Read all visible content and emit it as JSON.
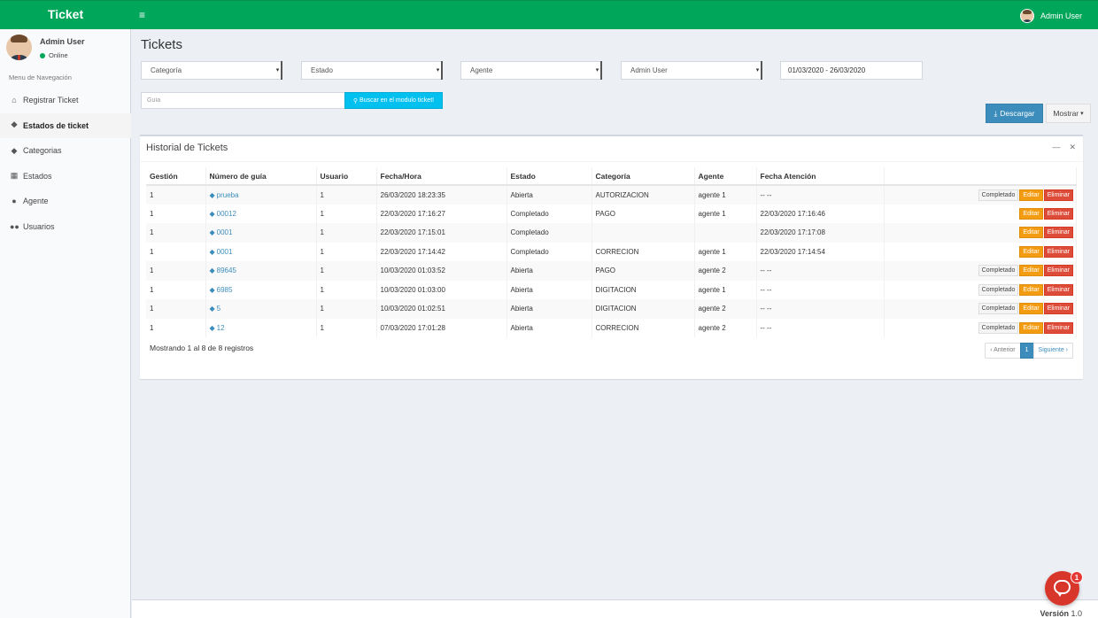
{
  "header": {
    "brand": "Ticket",
    "menu_icon": "hamburger-icon",
    "user_name": "Admin User"
  },
  "sidebar": {
    "user": {
      "name": "Admin User",
      "status": "Online"
    },
    "nav_header": "Menu de Navegación",
    "items": [
      {
        "label": "Registrar Ticket",
        "icon": "home-icon"
      },
      {
        "label": "Estados de ticket",
        "icon": "tags-icon",
        "active": true
      },
      {
        "label": "Categorias",
        "icon": "tag-icon"
      },
      {
        "label": "Estados",
        "icon": "grid-icon"
      },
      {
        "label": "Agente",
        "icon": "user-icon"
      },
      {
        "label": "Usuarios",
        "icon": "users-icon"
      }
    ]
  },
  "page": {
    "title": "Tickets"
  },
  "filters": {
    "categoria": "Categoría",
    "estado": "Estado",
    "agente": "Agente",
    "usuario": "Admin User",
    "date_range": "01/03/2020 - 26/03/2020"
  },
  "search": {
    "placeholder": "Guía",
    "button_label": "Buscar en el modulo ticket!"
  },
  "toolbar": {
    "download_label": "Descargar",
    "show_label": "Mostrar"
  },
  "box": {
    "title": "Historial de Tickets",
    "columns": [
      "Gestión",
      "Número de guía",
      "Usuario",
      "Fecha/Hora",
      "Estado",
      "Categoría",
      "Agente",
      "Fecha Atención",
      ""
    ],
    "rows": [
      {
        "gestion": "1",
        "guia": "prueba",
        "usuario": "1",
        "fecha": "26/03/2020 18:23:35",
        "estado": "Abierta",
        "categoria": "AUTORIZACION",
        "agente": "agente 1",
        "atencion": "-- --",
        "completado": true
      },
      {
        "gestion": "1",
        "guia": "00012",
        "usuario": "1",
        "fecha": "22/03/2020 17:16:27",
        "estado": "Completado",
        "categoria": "PAGO",
        "agente": "agente 1",
        "atencion": "22/03/2020 17:16:46",
        "completado": false
      },
      {
        "gestion": "1",
        "guia": "0001",
        "usuario": "1",
        "fecha": "22/03/2020 17:15:01",
        "estado": "Completado",
        "categoria": "",
        "agente": "",
        "atencion": "22/03/2020 17:17:08",
        "completado": false
      },
      {
        "gestion": "1",
        "guia": "0001",
        "usuario": "1",
        "fecha": "22/03/2020 17:14:42",
        "estado": "Completado",
        "categoria": "CORRECION",
        "agente": "agente 1",
        "atencion": "22/03/2020 17:14:54",
        "completado": false
      },
      {
        "gestion": "1",
        "guia": "89645",
        "usuario": "1",
        "fecha": "10/03/2020 01:03:52",
        "estado": "Abierta",
        "categoria": "PAGO",
        "agente": "agente 2",
        "atencion": "-- --",
        "completado": true
      },
      {
        "gestion": "1",
        "guia": "6985",
        "usuario": "1",
        "fecha": "10/03/2020 01:03:00",
        "estado": "Abierta",
        "categoria": "DIGITACION",
        "agente": "agente 1",
        "atencion": "-- --",
        "completado": true
      },
      {
        "gestion": "1",
        "guia": "5",
        "usuario": "1",
        "fecha": "10/03/2020 01:02:51",
        "estado": "Abierta",
        "categoria": "DIGITACION",
        "agente": "agente 2",
        "atencion": "-- --",
        "completado": true
      },
      {
        "gestion": "1",
        "guia": "12",
        "usuario": "1",
        "fecha": "07/03/2020 17:01:28",
        "estado": "Abierta",
        "categoria": "CORRECION",
        "agente": "agente 2",
        "atencion": "-- --",
        "completado": true
      }
    ],
    "actions": {
      "completado": "Completado",
      "editar": "Editar",
      "eliminar": "Eliminar"
    },
    "info": "Mostrando 1 al 8 de 8 registros",
    "pager": {
      "prev": "‹ Anterior",
      "current": "1",
      "next": "Siguiente ›"
    }
  },
  "footer": {
    "version_label": "Versión",
    "version_number": "1.0"
  },
  "chat": {
    "badge": "1"
  },
  "colors": {
    "header": "#00a65a",
    "info_button": "#00c0ef",
    "primary": "#3c8dbc",
    "warning": "#f39c12",
    "danger": "#dd4b39"
  }
}
